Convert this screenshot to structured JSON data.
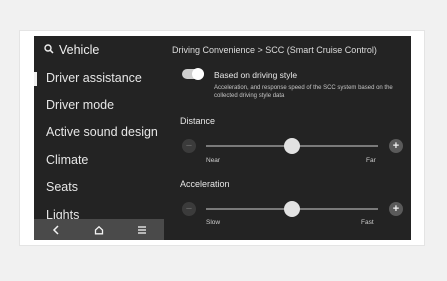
{
  "sidebar": {
    "search_label": "Vehicle",
    "items": [
      {
        "label": "Driver assistance"
      },
      {
        "label": "Driver mode"
      },
      {
        "label": "Active sound design"
      },
      {
        "label": "Climate"
      },
      {
        "label": "Seats"
      },
      {
        "label": "Lights"
      }
    ],
    "active_index": 0
  },
  "bottom_bar": {
    "icons": [
      "back-icon",
      "home-icon",
      "menu-icon"
    ]
  },
  "main": {
    "breadcrumb": "Driving Convenience > SCC (Smart Cruise Control)",
    "toggle": {
      "label": "Based on driving style",
      "description": "Acceleration, and response speed of the SCC system based on the collected driving style data",
      "enabled": true
    },
    "distance": {
      "title": "Distance",
      "min_label": "Near",
      "max_label": "Far",
      "level": 0.5
    },
    "acceleration": {
      "title": "Acceleration",
      "min_label": "Slow",
      "max_label": "Fast",
      "level": 0.5
    }
  },
  "colors": {
    "screen_background": "#232323",
    "bottom_bar": "#4a4a4a",
    "text": "#e8e8e8"
  }
}
